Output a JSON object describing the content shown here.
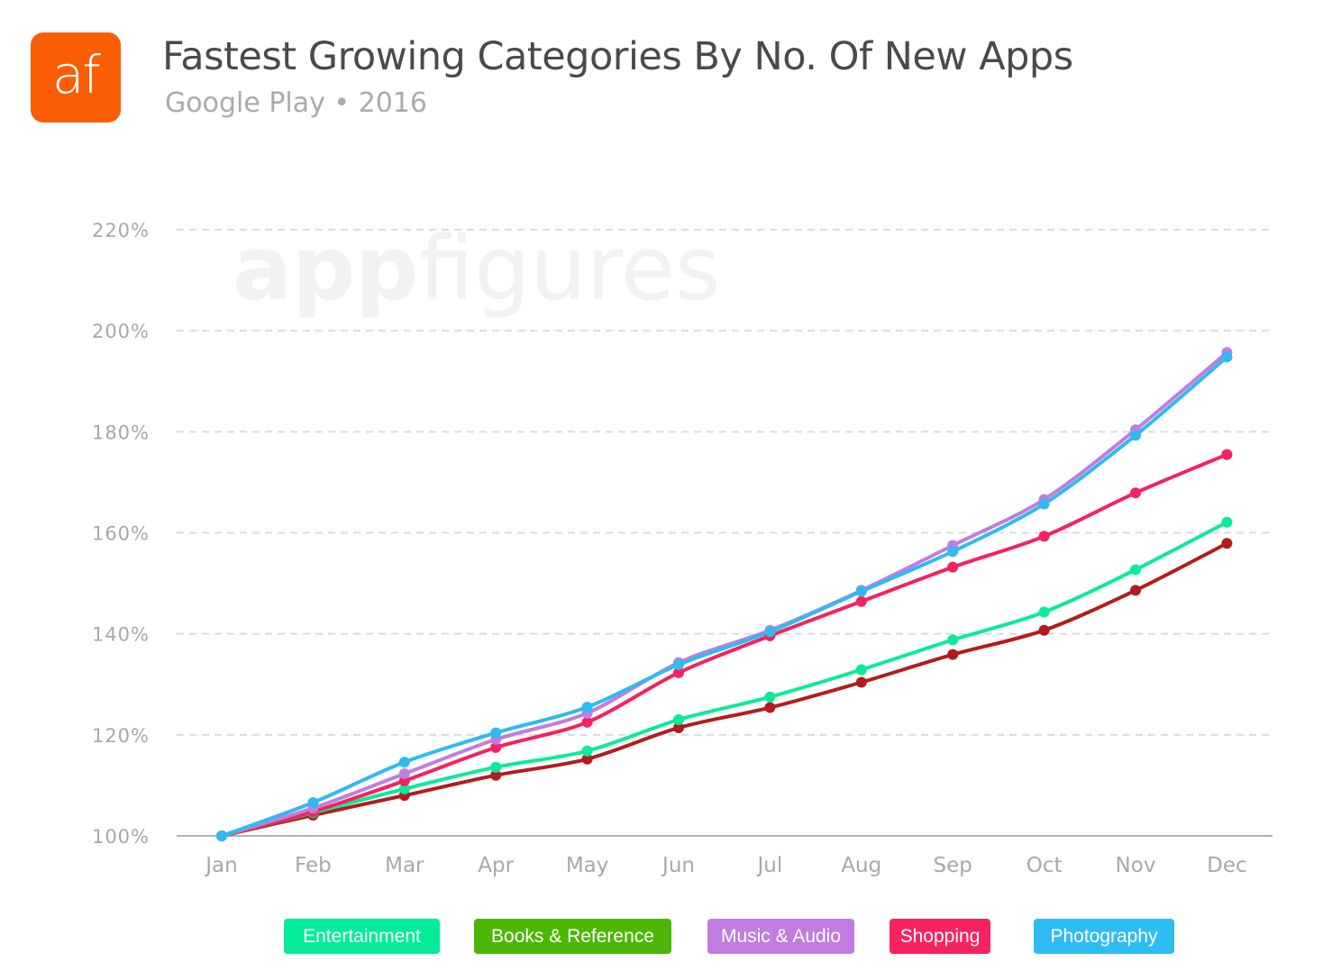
{
  "header": {
    "logo_text": "af",
    "logo_color": "#fa5e05",
    "title": "Fastest Growing Categories By No. Of New Apps",
    "subtitle": "Google Play • 2016"
  },
  "watermark": {
    "bold_part": "app",
    "light_part": "figures"
  },
  "chart_data": {
    "type": "line",
    "title": "Fastest Growing Categories By No. Of New Apps",
    "subtitle": "Google Play • 2016",
    "xlabel": "",
    "ylabel": "",
    "categories": [
      "Jan",
      "Feb",
      "Mar",
      "Apr",
      "May",
      "Jun",
      "Jul",
      "Aug",
      "Sep",
      "Oct",
      "Nov",
      "Dec"
    ],
    "ylim": [
      100,
      220
    ],
    "yticks": [
      100,
      120,
      140,
      160,
      180,
      200,
      220
    ],
    "ytick_labels": [
      "100%",
      "120%",
      "140%",
      "160%",
      "180%",
      "200%",
      "220%"
    ],
    "grid": true,
    "legend_position": "bottom",
    "series": [
      {
        "name": "Entertainment",
        "line_color": "#0aeb98",
        "legend_color": "#05ec99",
        "values": [
          100,
          104.6,
          109.3,
          113.6,
          116.8,
          123.0,
          127.5,
          132.9,
          138.8,
          144.3,
          152.7,
          162.1
        ]
      },
      {
        "name": "Books & Reference",
        "line_color": "#b31c1c",
        "legend_color": "#4cb706",
        "values": [
          100,
          104.1,
          108.0,
          112.0,
          115.2,
          121.4,
          125.4,
          130.4,
          135.9,
          140.7,
          148.6,
          157.9
        ]
      },
      {
        "name": "Music & Audio",
        "line_color": "#c07ddf",
        "legend_color": "#c07ddf",
        "values": [
          100,
          105.5,
          112.3,
          119.1,
          124.3,
          134.3,
          140.7,
          148.6,
          157.5,
          166.6,
          180.4,
          195.7
        ]
      },
      {
        "name": "Shopping",
        "line_color": "#f4225e",
        "legend_color": "#f7235f",
        "values": [
          100,
          104.8,
          110.9,
          117.5,
          122.5,
          132.3,
          139.6,
          146.4,
          153.2,
          159.3,
          167.9,
          175.5
        ]
      },
      {
        "name": "Photography",
        "line_color": "#2fbaf1",
        "legend_color": "#2fbcf3",
        "values": [
          100,
          106.6,
          114.6,
          120.4,
          125.5,
          133.9,
          140.4,
          148.4,
          156.3,
          165.7,
          179.3,
          194.8
        ]
      }
    ]
  }
}
